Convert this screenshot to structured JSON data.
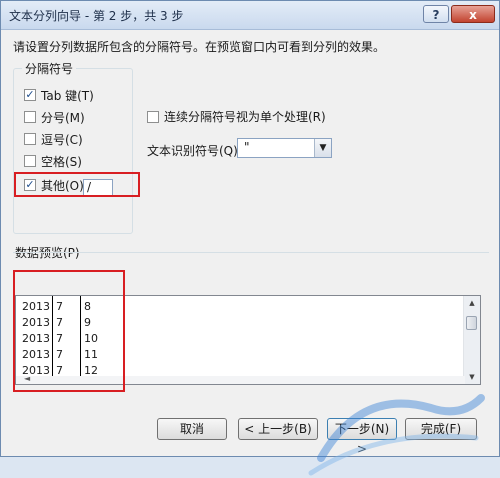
{
  "window": {
    "title": "文本分列向导 - 第 2 步，共 3 步",
    "help_label": "?",
    "close_label": "x"
  },
  "instruction": "请设置分列数据所包含的分隔符号。在预览窗口内可看到分列的效果。",
  "delimiters": {
    "group_title": "分隔符号",
    "tab": {
      "label": "Tab 键(T)",
      "checked": true
    },
    "semicolon": {
      "label": "分号(M)",
      "checked": false
    },
    "comma": {
      "label": "逗号(C)",
      "checked": false
    },
    "space": {
      "label": "空格(S)",
      "checked": false
    },
    "other": {
      "label": "其他(O):",
      "checked": true,
      "value": "/"
    }
  },
  "options": {
    "consecutive": {
      "label": "连续分隔符号视为单个处理(R)",
      "checked": false
    },
    "qualifier_label": "文本识别符号(Q):",
    "qualifier_value": "\""
  },
  "preview": {
    "label": "数据预览(P)",
    "rows": [
      [
        "2013",
        "7",
        "8"
      ],
      [
        "2013",
        "7",
        "9"
      ],
      [
        "2013",
        "7",
        "10"
      ],
      [
        "2013",
        "7",
        "11"
      ],
      [
        "2013",
        "7",
        "12"
      ]
    ]
  },
  "buttons": {
    "cancel": "取消",
    "back": "< 上一步(B)",
    "next": "下一步(N) >",
    "finish": "完成(F)"
  },
  "icons": {
    "check": "✓",
    "dropdown": "▼",
    "scroll_up": "▲",
    "scroll_down": "▼",
    "scroll_left": "◄"
  }
}
